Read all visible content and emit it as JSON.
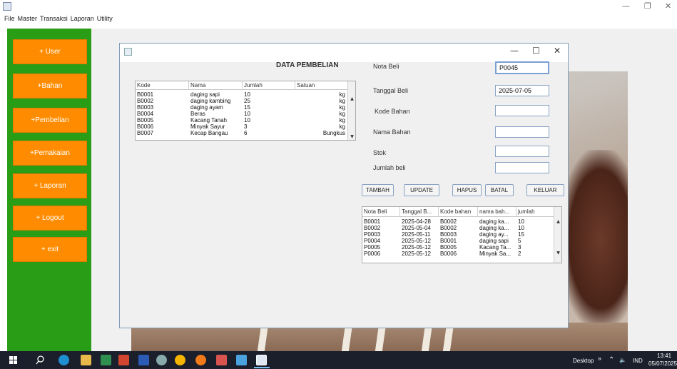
{
  "menu": [
    "File",
    "Master",
    "Transaksi",
    "Laporan",
    "Utility"
  ],
  "sidebar": {
    "buttons": [
      "+ User",
      "+Bahan",
      "+Pembelian",
      "+Pemakaian",
      "+ Laporan",
      "+ Logout",
      "+ exit"
    ]
  },
  "heading": "DATA PEMBELIAN",
  "bahan_table": {
    "headers": [
      "Kode",
      "Nama",
      "Jumlah",
      "Satuan"
    ],
    "rows": [
      [
        "B0001",
        "daging sapi",
        "10",
        "kg"
      ],
      [
        "B0002",
        "daging kambing",
        "25",
        "kg"
      ],
      [
        "B0003",
        "daging ayam",
        "15",
        "kg"
      ],
      [
        "B0004",
        "Beras",
        "10",
        "kg"
      ],
      [
        "B0005",
        "Kacang Tanah",
        "10",
        "kg"
      ],
      [
        "B0006",
        "Minyak Sayur",
        "3",
        "kg"
      ],
      [
        "B0007",
        "Kecap Bangau",
        "6",
        "Bungkus"
      ]
    ]
  },
  "form": {
    "nota_label": "Nota Beli",
    "nota_value": "P0045",
    "tanggal_label": "Tanggal Beli",
    "tanggal_value": "2025-07-05",
    "kode_label": "Kode Bahan",
    "kode_value": "",
    "nama_label": "Nama Bahan",
    "nama_value": "",
    "stok_label": "Stok",
    "stok_value": "",
    "jumlah_label": "Jumlah beli",
    "jumlah_value": ""
  },
  "actions": {
    "tambah": "TAMBAH",
    "update": "UPDATE",
    "hapus": "HAPUS",
    "batal": "BATAL",
    "keluar": "KELUAR"
  },
  "pembelian_table": {
    "headers": [
      "Nota Beli",
      "Tanggal B...",
      "Kode bahan",
      "nama bah...",
      "jumlah"
    ],
    "rows": [
      [
        "B0001",
        "2025-04-28",
        "B0002",
        "daging ka...",
        "10"
      ],
      [
        "B0002",
        "2025-05-04",
        "B0002",
        "daging ka...",
        "10"
      ],
      [
        "P0003",
        "2025-05-11",
        "B0003",
        "daging ay...",
        "15"
      ],
      [
        "P0004",
        "2025-05-12",
        "B0001",
        "daging sapi",
        "5"
      ],
      [
        "P0005",
        "2025-05-12",
        "B0005",
        "Kacang Ta...",
        "3"
      ],
      [
        "P0006",
        "2025-05-12",
        "B0006",
        "Minyak Sa...",
        "2"
      ]
    ]
  },
  "taskbar": {
    "desktop_label": "Desktop",
    "lang": "IND",
    "time": "13:41",
    "date": "05/07/2025"
  }
}
